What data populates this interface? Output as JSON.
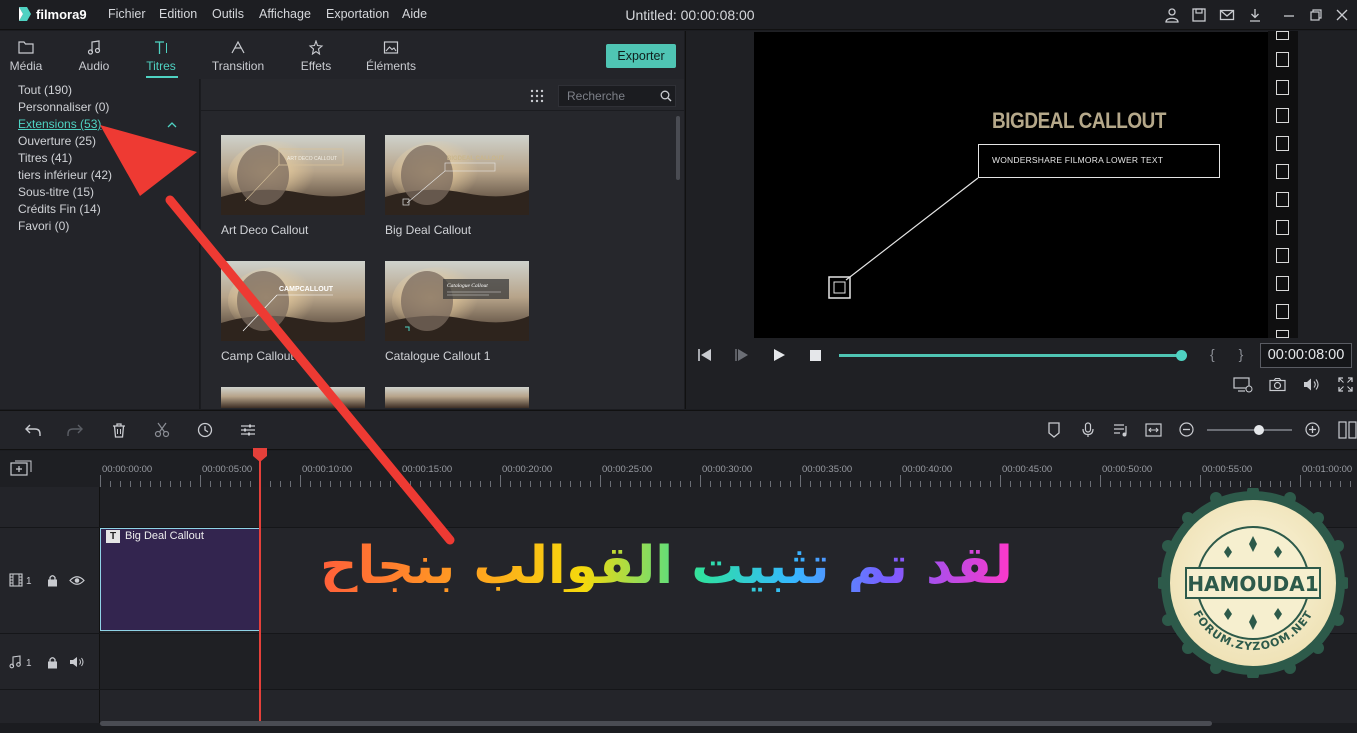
{
  "app": {
    "logo_text": "filmora9",
    "title": "Untitled: 00:00:08:00"
  },
  "menu": [
    "Fichier",
    "Edition",
    "Outils",
    "Affichage",
    "Exportation",
    "Aide"
  ],
  "library_tabs": [
    {
      "label": "Média",
      "icon": "folder-icon"
    },
    {
      "label": "Audio",
      "icon": "music-note-icon"
    },
    {
      "label": "Titres",
      "icon": "text-icon",
      "active": true
    },
    {
      "label": "Transition",
      "icon": "transition-icon"
    },
    {
      "label": "Effets",
      "icon": "effects-icon"
    },
    {
      "label": "Éléments",
      "icon": "image-icon"
    }
  ],
  "export_label": "Exporter",
  "categories": [
    {
      "label": "Tout (190)"
    },
    {
      "label": "Personnaliser (0)"
    },
    {
      "label": "Extensions (53)",
      "active": true
    },
    {
      "label": "Ouverture (25)"
    },
    {
      "label": "Titres (41)"
    },
    {
      "label": "tiers inférieur (42)"
    },
    {
      "label": "Sous-titre (15)"
    },
    {
      "label": "Crédits Fin (14)"
    },
    {
      "label": "Favori (0)"
    }
  ],
  "search": {
    "placeholder": "Recherche"
  },
  "thumbnails": [
    {
      "label": "Art Deco Callout",
      "overlay": "ART DECO CALLOUT"
    },
    {
      "label": "Big Deal Callout",
      "overlay": "BIGDEAL CALLOUT"
    },
    {
      "label": "Camp Callout",
      "overlay": "CAMPCALLOUT"
    },
    {
      "label": "Catalogue Callout 1",
      "overlay": "Catalogue Callout"
    }
  ],
  "preview": {
    "title": "BIGDEAL CALLOUT",
    "subtitle": "WONDERSHARE FILMORA LOWER TEXT",
    "timecode": "00:00:08:00",
    "progress": 1.0,
    "braces": "{ }"
  },
  "timeline": {
    "ruler_labels": [
      "00:00:00:00",
      "00:00:05:00",
      "00:00:10:00",
      "00:00:15:00",
      "00:00:20:00",
      "00:00:25:00",
      "00:00:30:00",
      "00:00:35:00",
      "00:00:40:00",
      "00:00:45:00",
      "00:00:50:00",
      "00:00:55:00",
      "00:01:00:00"
    ],
    "video_track_label": "1",
    "audio_track_label": "1",
    "clip": {
      "icon_letter": "T",
      "label": "Big Deal Callout"
    },
    "zoom_level": 0.6
  },
  "overlay": {
    "arabic_text": "لقد تم تثبيت القوالب بنجاح",
    "arrow_color": "#ee3a33",
    "accent_color": "#4fd2c2"
  },
  "seal": {
    "center_text": "HAMOUDA1",
    "arc_text": "FORUM.ZYZOOM.NET"
  }
}
